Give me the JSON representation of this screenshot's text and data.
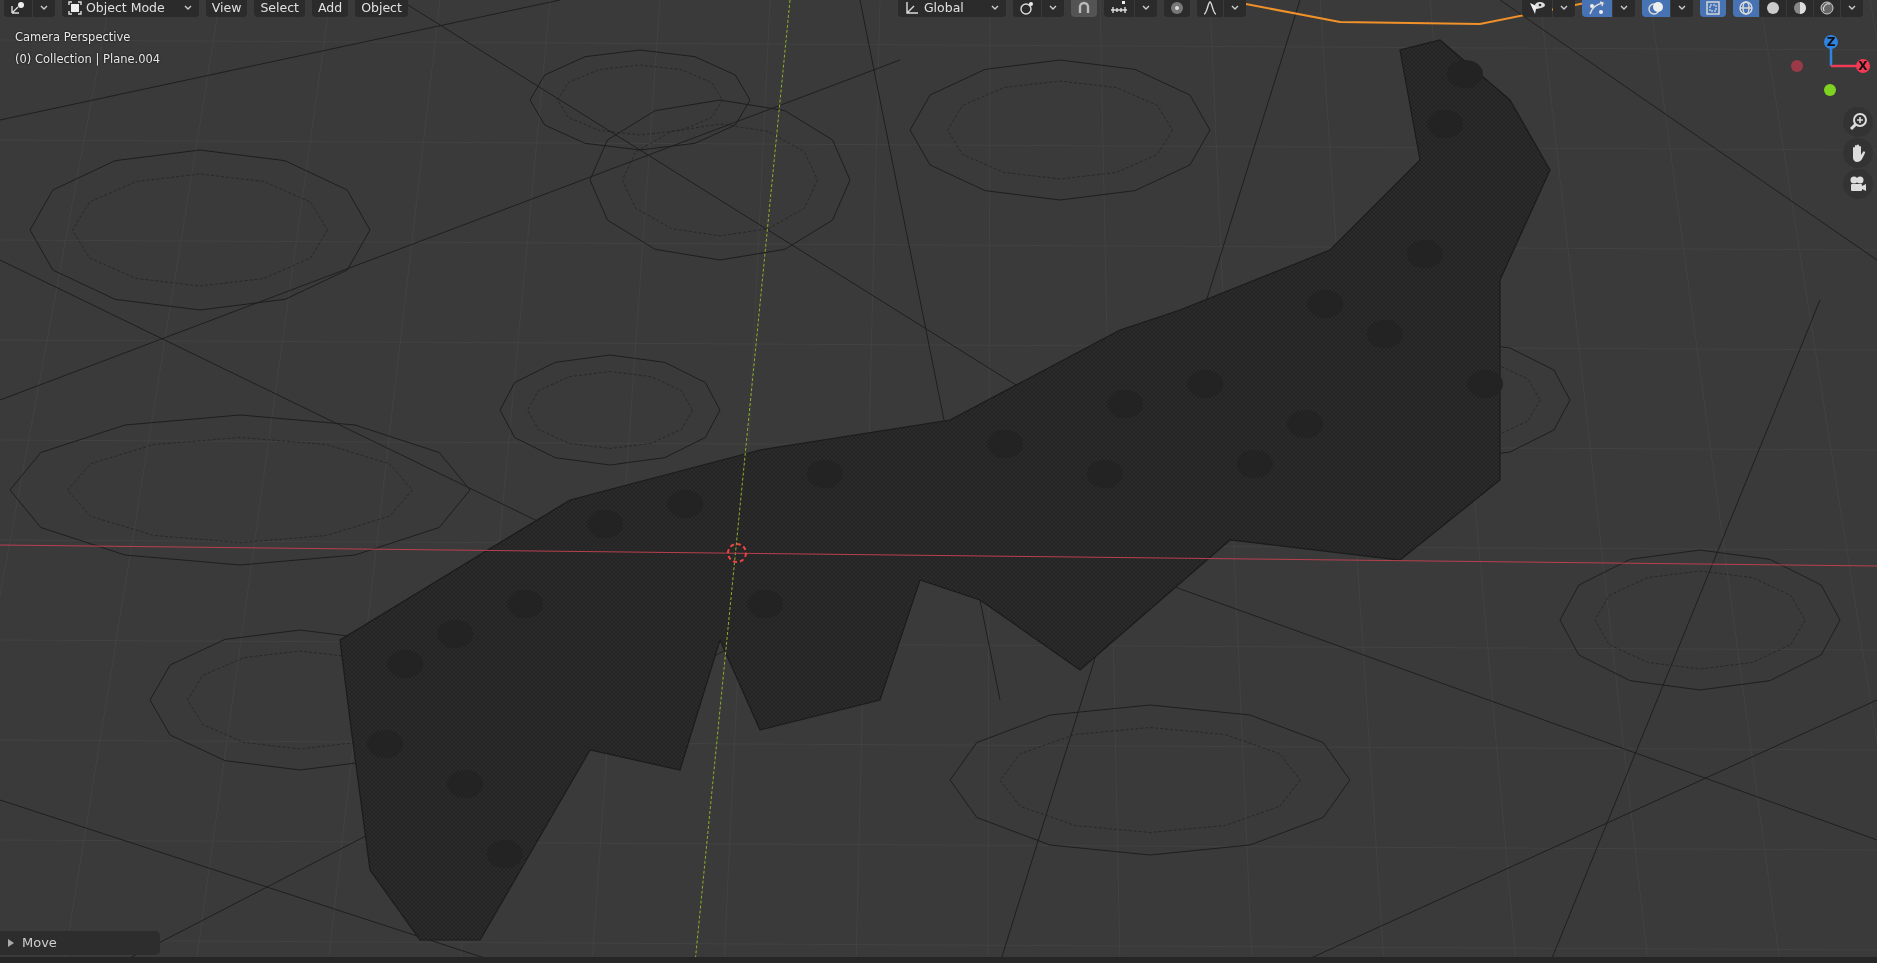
{
  "header_left": [
    {
      "kind": "editor"
    },
    {
      "kind": "mode",
      "label": "Object Mode"
    },
    {
      "kind": "menu",
      "label": "View"
    },
    {
      "kind": "menu",
      "label": "Select"
    },
    {
      "kind": "menu",
      "label": "Add"
    },
    {
      "kind": "menu",
      "label": "Object"
    }
  ],
  "header_center": [
    {
      "kind": "orientation",
      "label": "Global"
    },
    {
      "kind": "pivot"
    },
    {
      "kind": "snap",
      "on": false
    },
    {
      "kind": "snap_target"
    },
    {
      "kind": "proportional",
      "on": false
    },
    {
      "kind": "falloff"
    }
  ],
  "header_right": [
    {
      "kind": "visibility"
    },
    {
      "kind": "gizmos",
      "on": true
    },
    {
      "kind": "overlays",
      "on": true
    },
    {
      "kind": "xray",
      "on": true
    },
    {
      "kind": "shading",
      "modes": [
        {
          "kind": "wireframe",
          "selected": true
        },
        {
          "kind": "solid",
          "selected": false
        },
        {
          "kind": "material",
          "selected": false
        },
        {
          "kind": "rendered",
          "selected": false
        }
      ]
    }
  ],
  "viewport_info": [
    "Camera Perspective",
    "(0) Collection | Plane.004"
  ],
  "gizmo_axes": [
    {
      "label": "Z",
      "color": "#2f84e3"
    },
    {
      "label": "X",
      "color": "#f23a54"
    }
  ],
  "last_operator": {
    "label": "Move",
    "expanded": false
  }
}
